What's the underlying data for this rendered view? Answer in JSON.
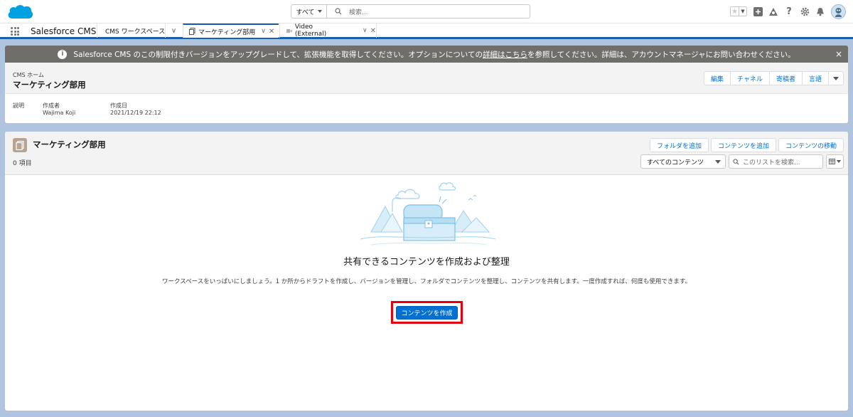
{
  "header": {
    "search_scope": "すべて",
    "search_placeholder": "検索..."
  },
  "nav": {
    "app_name": "Salesforce CMS",
    "tabs": [
      {
        "label": "CMS ワークスペース"
      },
      {
        "label": "マーケティング部用"
      },
      {
        "label": "Video (External)"
      }
    ]
  },
  "banner": {
    "text_before": "Salesforce CMS のこの制限付きバージョンをアップグレードして、拡張機能を取得してください。オプションについての",
    "link": "詳細はこちら",
    "text_after": "を参照してください。詳細は、アカウントマネージャにお問い合わせください。",
    "close": "×"
  },
  "record": {
    "breadcrumb": "CMS ホーム",
    "title": "マーケティング部用",
    "actions": [
      "編集",
      "チャネル",
      "寄稿者",
      "言語"
    ],
    "fields": {
      "description_label": "説明",
      "creator_label": "作成者",
      "creator_value": "Wajima Koji",
      "created_label": "作成日",
      "created_value": "2021/12/19 22:12"
    }
  },
  "list": {
    "title": "マーケティング部用",
    "count": "0 項目",
    "buttons": [
      "フォルダを追加",
      "コンテンツを追加",
      "コンテンツの移動"
    ],
    "filter_value": "すべてのコンテンツ",
    "search_placeholder": "このリストを検索..."
  },
  "empty_state": {
    "title": "共有できるコンテンツを作成および整理",
    "description": "ワークスペースをいっぱいにしましょう。1 か所からドラフトを作成し、バージョンを管理し、フォルダでコンテンツを整理し、コンテンツを共有します。一度作成すれば、何度も使用できます。",
    "create_button": "コンテンツを作成"
  },
  "colors": {
    "brand_blue": "#0070d2",
    "highlight_red": "#e3000f",
    "banner_gray": "#706e6b"
  }
}
